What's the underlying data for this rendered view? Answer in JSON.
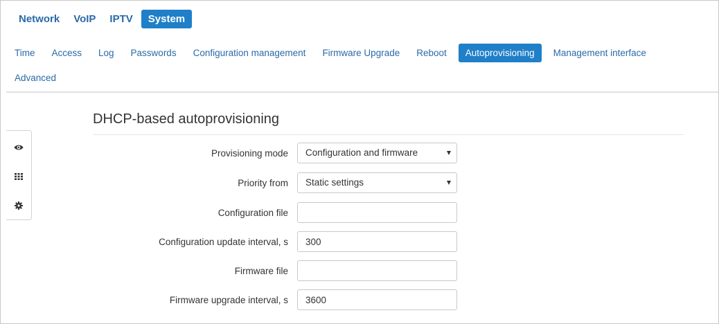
{
  "top_tabs": [
    {
      "label": "Network",
      "active": false
    },
    {
      "label": "VoIP",
      "active": false
    },
    {
      "label": "IPTV",
      "active": false
    },
    {
      "label": "System",
      "active": true
    }
  ],
  "sub_tabs": [
    {
      "label": "Time",
      "active": false
    },
    {
      "label": "Access",
      "active": false
    },
    {
      "label": "Log",
      "active": false
    },
    {
      "label": "Passwords",
      "active": false
    },
    {
      "label": "Configuration management",
      "active": false
    },
    {
      "label": "Firmware Upgrade",
      "active": false
    },
    {
      "label": "Reboot",
      "active": false
    },
    {
      "label": "Autoprovisioning",
      "active": true
    },
    {
      "label": "Management interface",
      "active": false
    },
    {
      "label": "Advanced",
      "active": false
    }
  ],
  "side_icons": [
    "eye-icon",
    "grid-icon",
    "gear-icon"
  ],
  "section": {
    "title": "DHCP-based autoprovisioning"
  },
  "form": {
    "provisioning_mode": {
      "label": "Provisioning mode",
      "value": "Configuration and firmware"
    },
    "priority_from": {
      "label": "Priority from",
      "value": "Static settings"
    },
    "configuration_file": {
      "label": "Configuration file",
      "value": ""
    },
    "config_update_interval": {
      "label": "Configuration update interval, s",
      "value": "300"
    },
    "firmware_file": {
      "label": "Firmware file",
      "value": ""
    },
    "firmware_upgrade_interval": {
      "label": "Firmware upgrade interval, s",
      "value": "3600"
    }
  },
  "colors": {
    "accent": "#1f7fc8",
    "link": "#2a6aa8"
  }
}
